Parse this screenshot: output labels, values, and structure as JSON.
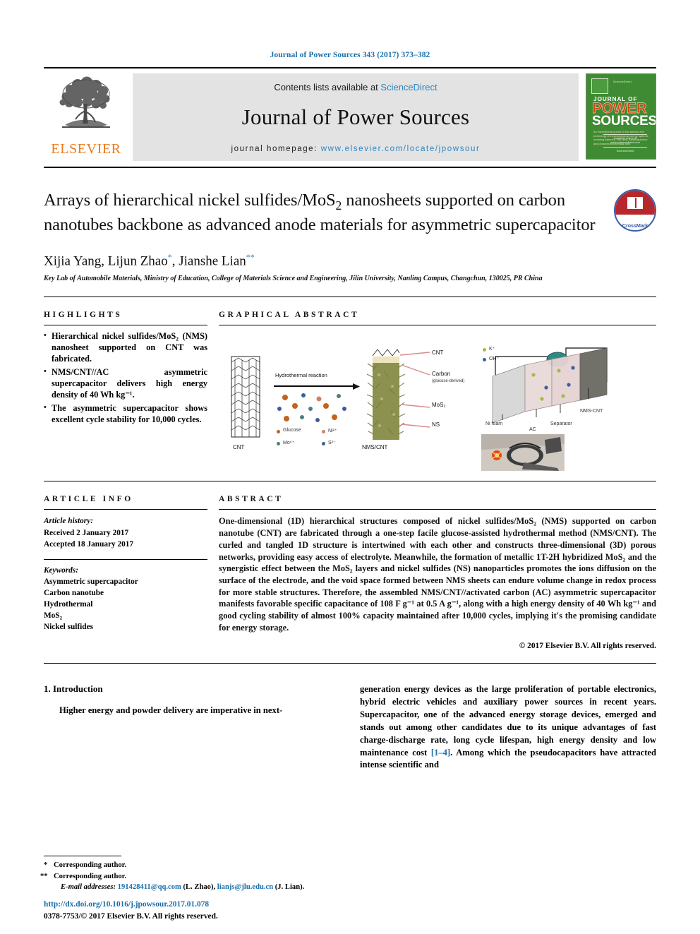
{
  "running_head": "Journal of Power Sources 343 (2017) 373–382",
  "masthead": {
    "contents_prefix": "Contents lists available at ",
    "sciencedirect": "ScienceDirect",
    "journal_name": "Journal of Power Sources",
    "homepage_prefix": "journal homepage: ",
    "homepage_url": "www.elsevier.com/locate/jpowsour",
    "publisher": "ELSEVIER",
    "publisher_color": "#ec7b1c",
    "link_color": "#2e86c0",
    "cover": {
      "top_small": "ScienceDirect",
      "line1": "JOURNAL OF",
      "line2": "POWER",
      "line3": "SOURCES",
      "blurb": "An international journal on the science and technology of electrochemical energy systems including batteries, fuel cells, supercapacitors and photoelectrochemical cells",
      "footer1": "Available online at www.sciencedirect.com",
      "footer2": "ScienceDirect",
      "bg_color": "#3f8b33",
      "accent_color": "#d9480f"
    }
  },
  "article": {
    "title_line1": "Arrays of hierarchical nickel sulfides/MoS",
    "title_sub1": "2",
    "title_line1b": " nanosheets supported on",
    "title_line2": "carbon nanotubes backbone as advanced anode materials for",
    "title_line3": "asymmetric supercapacitor",
    "crossmark_label": "CrossMark",
    "authors": "Xijia Yang, Lijun Zhao",
    "authors_mark1": "*",
    "authors_mid": ", Jianshe Lian",
    "authors_mark2": "**",
    "affiliation": "Key Lab of Automobile Materials, Ministry of Education, College of Materials Science and Engineering, Jilin University, Nanling Campus, Changchun, 130025, PR China"
  },
  "highlights": {
    "heading": "HIGHLIGHTS",
    "items": [
      "Hierarchical nickel sulfides/MoS₂ (NMS) nanosheet supported on CNT was fabricated.",
      "NMS/CNT//AC asymmetric supercapacitor delivers high energy density of 40 Wh kg⁻¹.",
      "The asymmetric supercapacitor shows excellent cycle stability for 10,000 cycles."
    ]
  },
  "graphical_abstract": {
    "heading": "GRAPHICAL ABSTRACT",
    "labels": {
      "cnt_left": "CNT",
      "reaction": "Hydrothermal reaction",
      "product": "NMS/CNT",
      "callout_cnt": "CNT",
      "callout_carbon": "Carbon",
      "callout_carbon_sub": "(glucose-derived)",
      "callout_mos2": "MoS₂",
      "callout_ns": "NS",
      "legend_glucose": "Glucose",
      "legend_ni": "Ni²⁺",
      "legend_mo": "Mo⁶⁺",
      "legend_s": "S²⁻",
      "dev_k": "K⁺",
      "dev_oh": "OH⁻",
      "dev_nifoam": "Ni foam",
      "dev_ac": "AC",
      "dev_separator": "Separator",
      "dev_nms": "NMS-CNT"
    },
    "colors": {
      "glucose": "#c1641f",
      "ni": "#d07f6a",
      "mo": "#4f7f7a",
      "s": "#3a5f9e",
      "plant": "#8d9150",
      "callout_line": "#d98b8b"
    }
  },
  "article_info": {
    "heading": "ARTICLE INFO",
    "history_label": "Article history:",
    "received": "Received 2 January 2017",
    "accepted": "Accepted 18 January 2017",
    "keywords_label": "Keywords:",
    "keywords": [
      "Asymmetric supercapacitor",
      "Carbon nanotube",
      "Hydrothermal",
      "MoS₂",
      "Nickel sulfides"
    ]
  },
  "abstract": {
    "heading": "ABSTRACT",
    "text": "One-dimensional (1D) hierarchical structures composed of nickel sulfides/MoS₂ (NMS) supported on carbon nanotube (CNT) are fabricated through a one-step facile glucose-assisted hydrothermal method (NMS/CNT). The curled and tangled 1D structure is intertwined with each other and constructs three-dimensional (3D) porous networks, providing easy access of electrolyte. Meanwhile, the formation of metallic 1T-2H hybridized MoS₂ and the synergistic effect between the MoS₂ layers and nickel sulfides (NS) nanoparticles promotes the ions diffusion on the surface of the electrode, and the void space formed between NMS sheets can endure volume change in redox process for more stable structures. Therefore, the assembled NMS/CNT//activated carbon (AC) asymmetric supercapacitor manifests favorable specific capacitance of 108 F g⁻¹ at 0.5 A g⁻¹, along with a high energy density of 40 Wh kg⁻¹ and good cycling stability of almost 100% capacity maintained after 10,000 cycles, implying it's the promising candidate for energy storage.",
    "copyright": "© 2017 Elsevier B.V. All rights reserved."
  },
  "body": {
    "section_number_title": "1. Introduction",
    "left_paragraph": "Higher energy and powder delivery are imperative in next-",
    "right_paragraph_a": "generation energy devices as the large proliferation of portable electronics, hybrid electric vehicles and auxiliary power sources in recent years. Supercapacitor, one of the advanced energy storage devices, emerged and stands out among other candidates due to its unique advantages of fast charge-discharge rate, long cycle lifespan, high energy density and low maintenance cost ",
    "right_reference": "[1–4]",
    "right_paragraph_b": ". Among which the pseudocapacitors have attracted intense scientific and"
  },
  "footnotes": {
    "corr1_mark": "*",
    "corr1": "Corresponding author.",
    "corr2_mark": "**",
    "corr2": "Corresponding author.",
    "email_label": "E-mail addresses:",
    "email1": "191428411@qq.com",
    "email1_owner": "(L. Zhao),",
    "email2": "lianjs@jlu.edu.cn",
    "email2_owner": "(J. Lian).",
    "doi": "http://dx.doi.org/10.1016/j.jpowsour.2017.01.078",
    "issn": "0378-7753/© 2017 Elsevier B.V. All rights reserved."
  }
}
